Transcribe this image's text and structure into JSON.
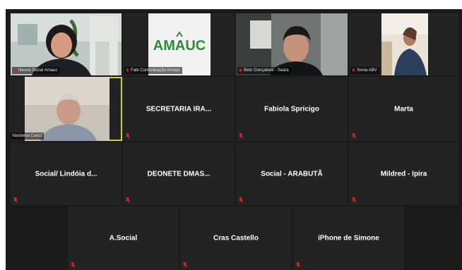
{
  "row1": [
    {
      "name": "Neusa Social Amauc",
      "type": "video"
    },
    {
      "name": "Fabi Comunicação Amauc",
      "type": "video",
      "logo_text": "AMAUC"
    },
    {
      "name": "Beto Gonçalves - Seara",
      "type": "video"
    },
    {
      "name": "Sonia ABV",
      "type": "video"
    }
  ],
  "row2": [
    {
      "name": "Vanderlei Canci",
      "type": "video"
    },
    {
      "name": "SECRETARIA IRA..."
    },
    {
      "name": "Fabiola Spricigo"
    },
    {
      "name": "Marta"
    }
  ],
  "row3": [
    {
      "name": "Social/ Lindóia d..."
    },
    {
      "name": "DEONETE DMAS..."
    },
    {
      "name": "Social - ARABUTÃ"
    },
    {
      "name": "Mildred - Ipira"
    }
  ],
  "row4": [
    {
      "name": "A.Social"
    },
    {
      "name": "Cras Castello"
    },
    {
      "name": "iPhone de Simone"
    }
  ],
  "colors": {
    "active_border": "#c9d14a",
    "muted_mic": "#d9272e",
    "logo_green": "#2e8b3a",
    "logo_bg": "#f2f2f2"
  },
  "icons": {
    "mic": "muted-microphone-icon"
  }
}
